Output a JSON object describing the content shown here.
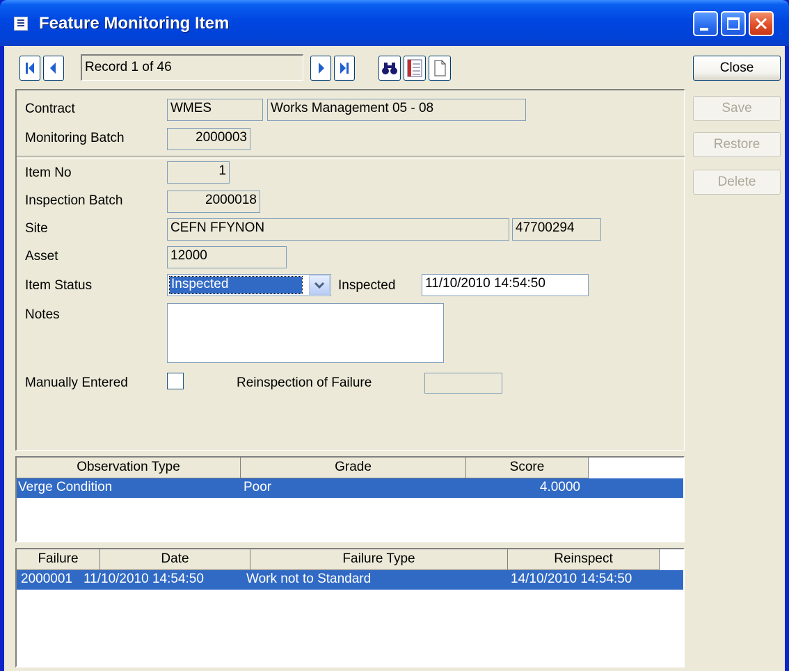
{
  "window": {
    "title": "Feature Monitoring Item"
  },
  "navigation": {
    "record_text": "Record 1 of 46"
  },
  "actions": {
    "close": "Close",
    "save": "Save",
    "restore": "Restore",
    "delete": "Delete"
  },
  "header": {
    "contract_label": "Contract",
    "contract_code": "WMES",
    "contract_name": "Works Management 05 - 08",
    "monitoring_batch_label": "Monitoring Batch",
    "monitoring_batch": "2000003"
  },
  "item": {
    "item_no_label": "Item No",
    "item_no": "1",
    "inspection_batch_label": "Inspection Batch",
    "inspection_batch": "2000018",
    "site_label": "Site",
    "site_name": "CEFN FFYNON",
    "site_code": "47700294",
    "asset_label": "Asset",
    "asset": "12000",
    "item_status_label": "Item Status",
    "item_status": "Inspected",
    "inspected_label": "Inspected",
    "inspected_datetime": "11/10/2010 14:54:50",
    "notes_label": "Notes",
    "notes": "",
    "manually_entered_label": "Manually Entered",
    "manually_entered": false,
    "reinspection_label": "Reinspection of Failure",
    "reinspection_of_failure": ""
  },
  "observations": {
    "columns": [
      "Observation Type",
      "Grade",
      "Score"
    ],
    "rows": [
      {
        "type": "Verge Condition",
        "grade": "Poor",
        "score": "4.0000"
      }
    ]
  },
  "failures": {
    "columns": [
      "Failure",
      "Date",
      "Failure Type",
      "Reinspect"
    ],
    "rows": [
      {
        "failure": "2000001",
        "date": "11/10/2010 14:54:50",
        "failure_type": "Work not to Standard",
        "reinspect": "14/10/2010 14:54:50"
      }
    ]
  },
  "colors": {
    "selection": "#316ac5",
    "titlebar": "#0046e0",
    "face": "#ece9d8",
    "field_border": "#7f9db9"
  }
}
